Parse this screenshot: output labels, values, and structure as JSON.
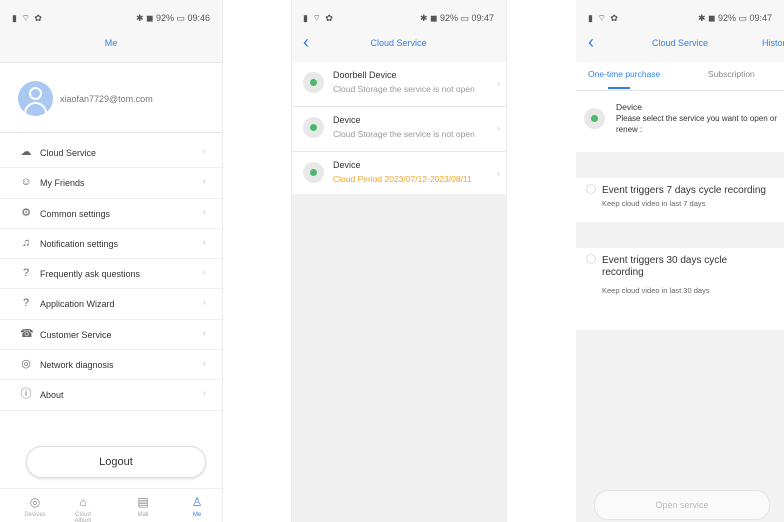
{
  "screen1": {
    "status_left": "▮ ⌔ ✿",
    "status_right": "✱ ◼ 92% ▭ 09:46",
    "title": "Me",
    "email": "xiaofan7729@tom.com",
    "menu": [
      {
        "label": "Cloud Service",
        "icon": "cloud-icon",
        "glyph": "☁"
      },
      {
        "label": "My Friends",
        "icon": "friends-icon",
        "glyph": "☺"
      },
      {
        "label": "Common settings",
        "icon": "settings-icon",
        "glyph": "⚙"
      },
      {
        "label": "Notification settings",
        "icon": "bell-icon",
        "glyph": "♫"
      },
      {
        "label": "Frequently ask questions",
        "icon": "question-icon",
        "glyph": "?"
      },
      {
        "label": "Application Wizard",
        "icon": "wizard-icon",
        "glyph": "?"
      },
      {
        "label": "Customer Service",
        "icon": "headset-icon",
        "glyph": "☎"
      },
      {
        "label": "Network diagnosis",
        "icon": "network-icon",
        "glyph": "◎"
      },
      {
        "label": "About",
        "icon": "info-icon",
        "glyph": "ⓘ"
      }
    ],
    "arrow": "›",
    "logout": "Logout",
    "tabs": [
      {
        "label": "Devices",
        "icon": "camera-icon",
        "glyph": "◎"
      },
      {
        "label": "Cloud Album",
        "icon": "cloud-album-icon",
        "glyph": "⌂"
      },
      {
        "label": "Mall",
        "icon": "mall-icon",
        "glyph": "▤"
      },
      {
        "label": "Me",
        "icon": "person-icon",
        "glyph": "♙"
      }
    ]
  },
  "screen2": {
    "status_left": "▮ ⌔ ✿",
    "status_right": "✱ ◼ 92% ▭ 09:47",
    "back": "‹",
    "title": "Cloud Service",
    "devices": [
      {
        "name": "Doorbell Device",
        "status": "Cloud Storage the service is not open",
        "active": false
      },
      {
        "name": "Device",
        "status": "Cloud Storage the service is not open",
        "active": false
      },
      {
        "name": "Device",
        "status": "Cloud Period 2023/07/12-2023/08/11",
        "active": true
      }
    ],
    "arrow": "›"
  },
  "screen3": {
    "status_left": "▮ ⌔ ✿",
    "status_right": "✱ ◼ 92% ▭ 09:47",
    "back": "‹",
    "title": "Cloud Service",
    "history": "History",
    "tab_onetime": "One-time purchase",
    "tab_subscription": "Subscription",
    "device_name": "Device",
    "device_desc": "Please select the service you want to open or renew :",
    "option1_title": "Event triggers 7 days cycle recording",
    "option1_sub": "Keep cloud video in last 7 days",
    "option2_title": "Event triggers 30 days cycle recording",
    "option2_sub": "Keep cloud video in last 30 days",
    "open_button": "Open service"
  },
  "colors": {
    "accent": "#2f7fe8",
    "active_period": "#f0a524",
    "online_dot": "#4bb86b"
  }
}
